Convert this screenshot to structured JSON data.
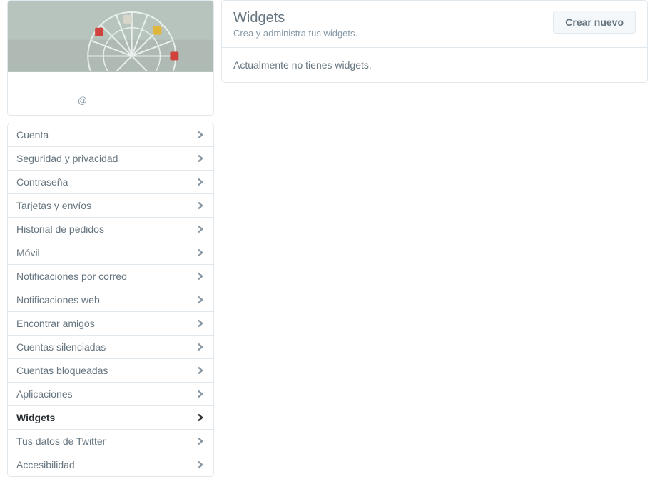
{
  "profile": {
    "handle": "@"
  },
  "nav": {
    "items": [
      {
        "label": "Cuenta",
        "active": false
      },
      {
        "label": "Seguridad y privacidad",
        "active": false
      },
      {
        "label": "Contraseña",
        "active": false
      },
      {
        "label": "Tarjetas y envíos",
        "active": false
      },
      {
        "label": "Historial de pedidos",
        "active": false
      },
      {
        "label": "Móvil",
        "active": false
      },
      {
        "label": "Notificaciones por correo",
        "active": false
      },
      {
        "label": "Notificaciones web",
        "active": false
      },
      {
        "label": "Encontrar amigos",
        "active": false
      },
      {
        "label": "Cuentas silenciadas",
        "active": false
      },
      {
        "label": "Cuentas bloqueadas",
        "active": false
      },
      {
        "label": "Aplicaciones",
        "active": false
      },
      {
        "label": "Widgets",
        "active": true
      },
      {
        "label": "Tus datos de Twitter",
        "active": false
      },
      {
        "label": "Accesibilidad",
        "active": false
      }
    ]
  },
  "main": {
    "title": "Widgets",
    "subtitle": "Crea y administra tus widgets.",
    "create_label": "Crear nuevo",
    "empty_text": "Actualmente no tienes widgets."
  },
  "colors": {
    "border": "#e1e8ed",
    "text": "#66757f",
    "text_muted": "#8899a6",
    "text_strong": "#292f33"
  }
}
